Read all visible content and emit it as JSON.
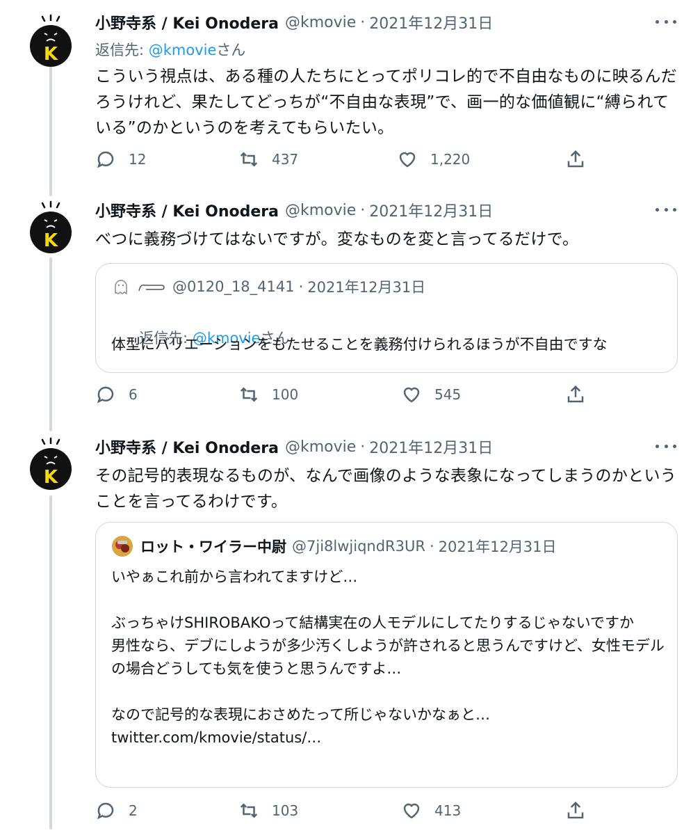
{
  "tweets": [
    {
      "name": "小野寺系 / Kei Onodera",
      "handle": "@kmovie",
      "dot": "·",
      "date": "2021年12月31日",
      "reply_prefix": "返信先: ",
      "reply_mention": "@kmovie",
      "reply_suffix": "さん",
      "text": "こういう視点は、ある種の人たちにとってポリコレ的で不自由なものに映るんだろうけれど、果たしてどっちが“不自由な表現”で、画一的な価値観に“縛られている”のかというのを考えてもらいたい。",
      "replies": "12",
      "retweets": "437",
      "likes": "1,220"
    },
    {
      "name": "小野寺系 / Kei Onodera",
      "handle": "@kmovie",
      "dot": "·",
      "date": "2021年12月31日",
      "text": "べつに義務づけてはないですが。変なものを変と言ってるだけで。",
      "quote": {
        "handle": "@0120_18_4141",
        "dot": "·",
        "date": "2021年12月31日",
        "reply_prefix": "返信先: ",
        "reply_mention": "@kmovie",
        "reply_suffix": "さん",
        "text": "体型にバリエーションをもたせることを義務付けられるほうが不自由ですな"
      },
      "replies": "6",
      "retweets": "100",
      "likes": "545"
    },
    {
      "name": "小野寺系 / Kei Onodera",
      "handle": "@kmovie",
      "dot": "·",
      "date": "2021年12月31日",
      "text": "その記号的表現なるものが、なんで画像のような表象になってしまうのかということを言ってるわけです。",
      "quote": {
        "name": "ロット・ワイラー中尉",
        "handle": "@7ji8lwjiqndR3UR",
        "dot": "·",
        "date": "2021年12月31日",
        "text": "いやぁこれ前から言われてますけど…\n\nぶっちゃけSHIROBAKOって結構実在の人モデルにしてたりするじゃないですか\n男性なら、デブにしようが多少汚くしようが許されると思うんですけど、女性モデルの場合どうしても気を使うと思うんですよ…\n\nなので記号的な表現におさめたって所じゃないかなぁと…\ntwitter.com/kmovie/status/…"
      },
      "replies": "2",
      "retweets": "103",
      "likes": "413"
    }
  ],
  "avatar_letter": "K",
  "colors": {
    "link": "#1d9bf0",
    "secondary": "#536471",
    "border": "#cfd9de",
    "avatar_k": "#f5d90a"
  }
}
